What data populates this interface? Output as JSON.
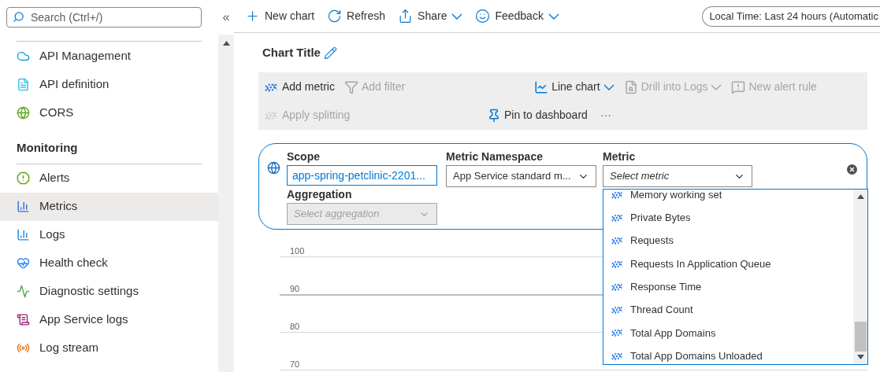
{
  "sidebar": {
    "search": {
      "placeholder": "Search (Ctrl+/)"
    },
    "collapse": "«",
    "groups": [
      {
        "items": [
          {
            "label": "API Management",
            "selected": false
          },
          {
            "label": "API definition",
            "selected": false
          },
          {
            "label": "CORS",
            "selected": false
          }
        ]
      },
      {
        "title": "Monitoring",
        "items": [
          {
            "label": "Alerts",
            "selected": false
          },
          {
            "label": "Metrics",
            "selected": true
          },
          {
            "label": "Logs",
            "selected": false
          },
          {
            "label": "Health check",
            "selected": false
          },
          {
            "label": "Diagnostic settings",
            "selected": false
          },
          {
            "label": "App Service logs",
            "selected": false
          },
          {
            "label": "Log stream",
            "selected": false
          }
        ]
      }
    ]
  },
  "toolbar": {
    "items": [
      {
        "kind": "plus",
        "label": "New chart",
        "caret": false
      },
      {
        "kind": "refresh",
        "label": "Refresh",
        "caret": false
      },
      {
        "kind": "share",
        "label": "Share",
        "caret": true
      },
      {
        "kind": "smile",
        "label": "Feedback",
        "caret": true
      }
    ],
    "time_range": "Local Time: Last 24 hours (Automatic"
  },
  "chart_title": "Chart Title",
  "actions": {
    "first_row": [
      {
        "kind": "metric",
        "label": "Add metric",
        "disabled": false,
        "caret": false
      },
      {
        "kind": "filter",
        "label": "Add filter",
        "disabled": true,
        "caret": false
      },
      {
        "kind": "line",
        "label": "Line chart",
        "disabled": false,
        "caret": true
      },
      {
        "kind": "logs",
        "label": "Drill into Logs",
        "disabled": true,
        "caret": true
      },
      {
        "kind": "alert",
        "label": "New alert rule",
        "disabled": true,
        "caret": false
      }
    ],
    "second_row": [
      {
        "kind": "split",
        "label": "Apply splitting",
        "disabled": true,
        "caret": false
      },
      {
        "kind": "pin",
        "label": "Pin to dashboard",
        "disabled": false,
        "caret": false
      }
    ],
    "more": "···"
  },
  "metric_editor": {
    "scope": {
      "label": "Scope",
      "value": "app-spring-petclinic-2201..."
    },
    "namespace": {
      "label": "Metric Namespace",
      "value": "App Service standard m..."
    },
    "metric": {
      "label": "Metric",
      "placeholder": "Select metric"
    },
    "aggregation": {
      "label": "Aggregation",
      "placeholder": "Select aggregation",
      "disabled": true
    },
    "metric_options": [
      "Memory working set",
      "Private Bytes",
      "Requests",
      "Requests In Application Queue",
      "Response Time",
      "Thread Count",
      "Total App Domains",
      "Total App Domains Unloaded"
    ]
  },
  "chart": {
    "y_labels": [
      "100",
      "90",
      "80",
      "70"
    ]
  }
}
